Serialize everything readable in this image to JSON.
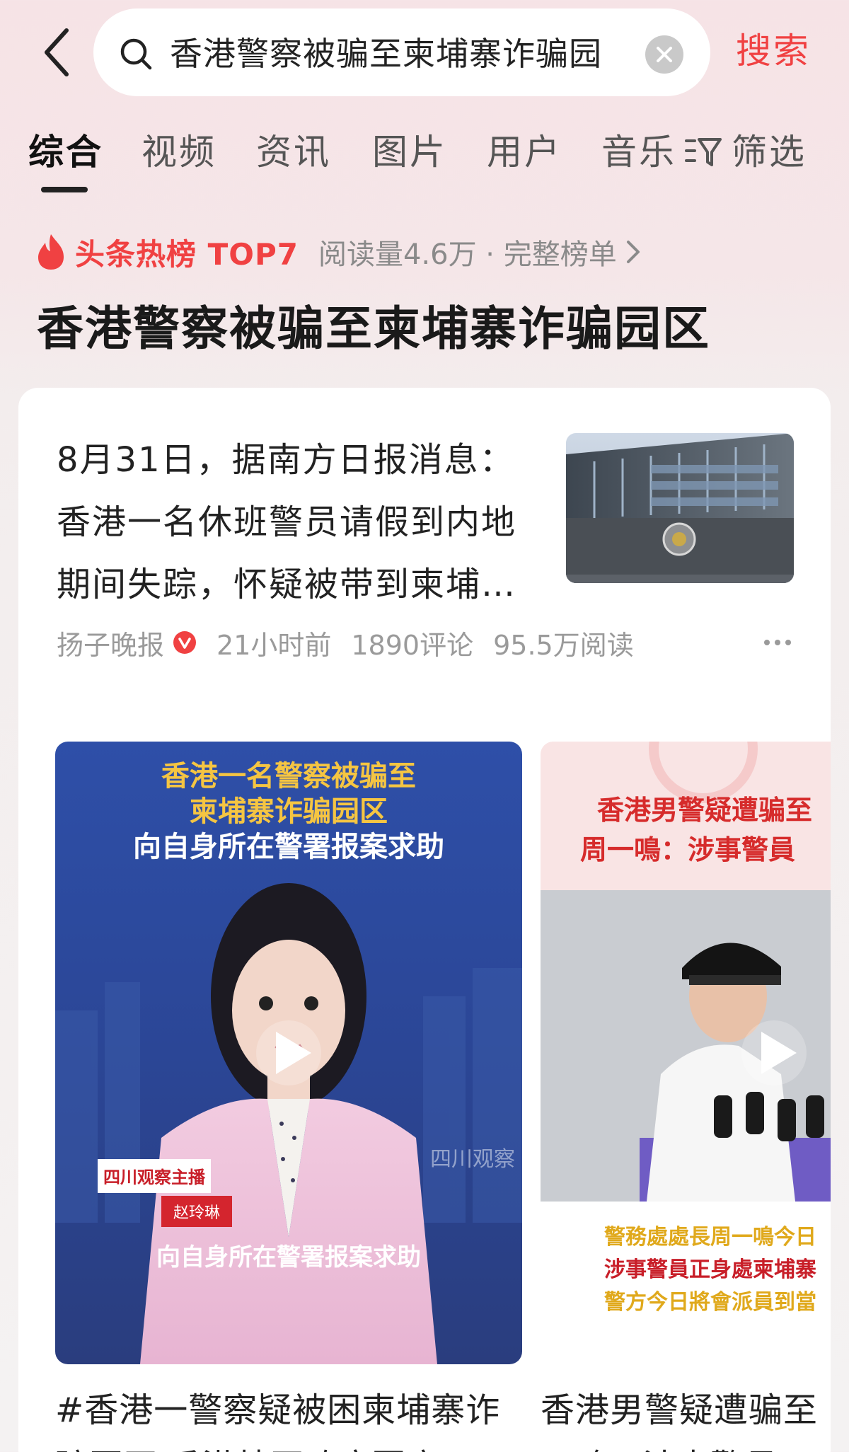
{
  "search": {
    "query": "香港警察被骗至柬埔寨诈骗园",
    "submit_label": "搜索"
  },
  "tabs": [
    {
      "label": "综合",
      "active": true
    },
    {
      "label": "视频"
    },
    {
      "label": "资讯"
    },
    {
      "label": "图片"
    },
    {
      "label": "用户"
    },
    {
      "label": "音乐"
    }
  ],
  "filter_label": "筛选",
  "hot": {
    "label": "头条热榜 TOP7",
    "meta": "阅读量4.6万 · 完整榜单"
  },
  "topic_title": "香港警察被骗至柬埔寨诈骗园区",
  "article": {
    "lines": [
      "8月31日，据南方日报消息：",
      "香港一名休班警员请假到内地",
      "期间失踪，怀疑被带到柬埔…"
    ],
    "source": "扬子晚报",
    "time": "21小时前",
    "comments": "1890评论",
    "reads": "95.5万阅读"
  },
  "video1": {
    "overlay_title_1": "香港一名警察被骗至",
    "overlay_title_2": "柬埔寨诈骗园区",
    "overlay_title_3": "向自身所在警署报案求助",
    "anchor_tag": "四川观察主播",
    "anchor_name": "赵玲琳",
    "subtitle": "向自身所在警署报案求助",
    "watermark": "四川观察",
    "caption_1": "#香港一警察疑被困柬埔寨诈",
    "caption_2": "骗园区 香港特区政府回应"
  },
  "video2": {
    "banner_1": "香港男警疑遭骗至",
    "banner_2": "周一鳴：涉事警員",
    "sub_1": "警務處處長周一鳴今日",
    "sub_2": "涉事警員正身處柬埔寨",
    "sub_3": "警方今日將會派員到當",
    "caption_1": "香港男警疑遭骗至",
    "caption_2": "…鸣：涉事警员"
  },
  "colors": {
    "accent": "#f04142",
    "bg_top": "#f6e3e6",
    "muted": "#9a9a9a"
  }
}
